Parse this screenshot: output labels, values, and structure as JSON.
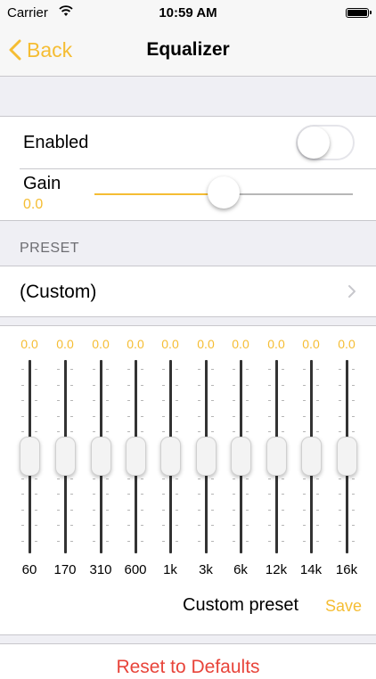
{
  "status_bar": {
    "carrier": "Carrier",
    "time": "10:59 AM"
  },
  "nav": {
    "back_label": "Back",
    "title": "Equalizer"
  },
  "settings": {
    "enabled_label": "Enabled",
    "enabled": false,
    "gain_label": "Gain",
    "gain_value": "0.0",
    "gain_level": 0.5
  },
  "preset": {
    "header": "PRESET",
    "current": "(Custom)"
  },
  "eq": {
    "bands": [
      {
        "freq": "60",
        "value": "0.0"
      },
      {
        "freq": "170",
        "value": "0.0"
      },
      {
        "freq": "310",
        "value": "0.0"
      },
      {
        "freq": "600",
        "value": "0.0"
      },
      {
        "freq": "1k",
        "value": "0.0"
      },
      {
        "freq": "3k",
        "value": "0.0"
      },
      {
        "freq": "6k",
        "value": "0.0"
      },
      {
        "freq": "12k",
        "value": "0.0"
      },
      {
        "freq": "14k",
        "value": "0.0"
      },
      {
        "freq": "16k",
        "value": "0.0"
      }
    ],
    "custom_preset_label": "Custom preset",
    "save_label": "Save"
  },
  "reset": {
    "label": "Reset to Defaults"
  },
  "colors": {
    "accent": "#f5bd33",
    "destructive": "#e8443a",
    "background": "#efeff4"
  }
}
